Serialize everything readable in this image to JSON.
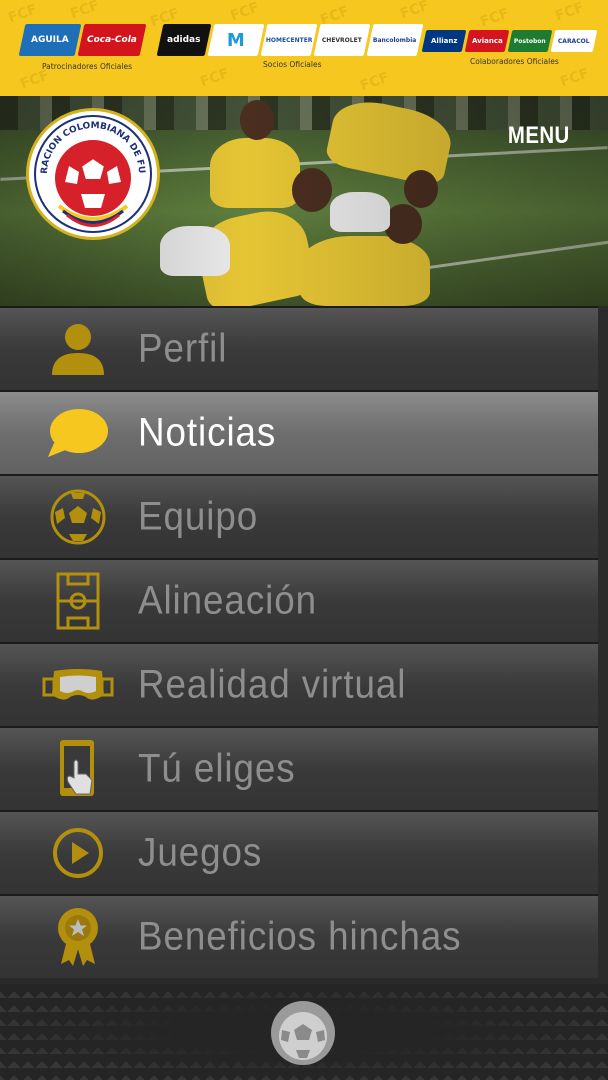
{
  "sponsors": {
    "patrocinadores": {
      "caption": "Patrocinadores Oficiales",
      "logos": [
        "AGUILA",
        "Coca-Cola"
      ]
    },
    "socios": {
      "caption": "Socios Oficiales",
      "logos": [
        "adidas",
        "M",
        "HOMECENTER",
        "CHEVROLET",
        "Bancolombia"
      ]
    },
    "colaboradores": {
      "caption": "Colaboradores Oficiales",
      "logos": [
        "Allianz",
        "Avianca",
        "Postobon",
        "CARACOL"
      ]
    },
    "watermark": "FCF"
  },
  "header": {
    "menu_title": "MENU",
    "crest_text": "FEDERACION COLOMBIANA DE FUTBOL"
  },
  "menu": {
    "items": [
      {
        "label": "Perfil",
        "icon": "user-icon"
      },
      {
        "label": "Noticias",
        "icon": "speech-bubble-icon",
        "active": true
      },
      {
        "label": "Equipo",
        "icon": "soccer-ball-icon"
      },
      {
        "label": "Alineación",
        "icon": "field-icon"
      },
      {
        "label": "Realidad virtual",
        "icon": "vr-headset-icon"
      },
      {
        "label": "Tú eliges",
        "icon": "phone-touch-icon"
      },
      {
        "label": "Juegos",
        "icon": "play-icon"
      },
      {
        "label": "Beneficios hinchas",
        "icon": "award-icon"
      }
    ]
  },
  "colors": {
    "accent": "#f6c81f",
    "icon_gold": "#b38f0e",
    "active_icon": "#f6c81f"
  }
}
